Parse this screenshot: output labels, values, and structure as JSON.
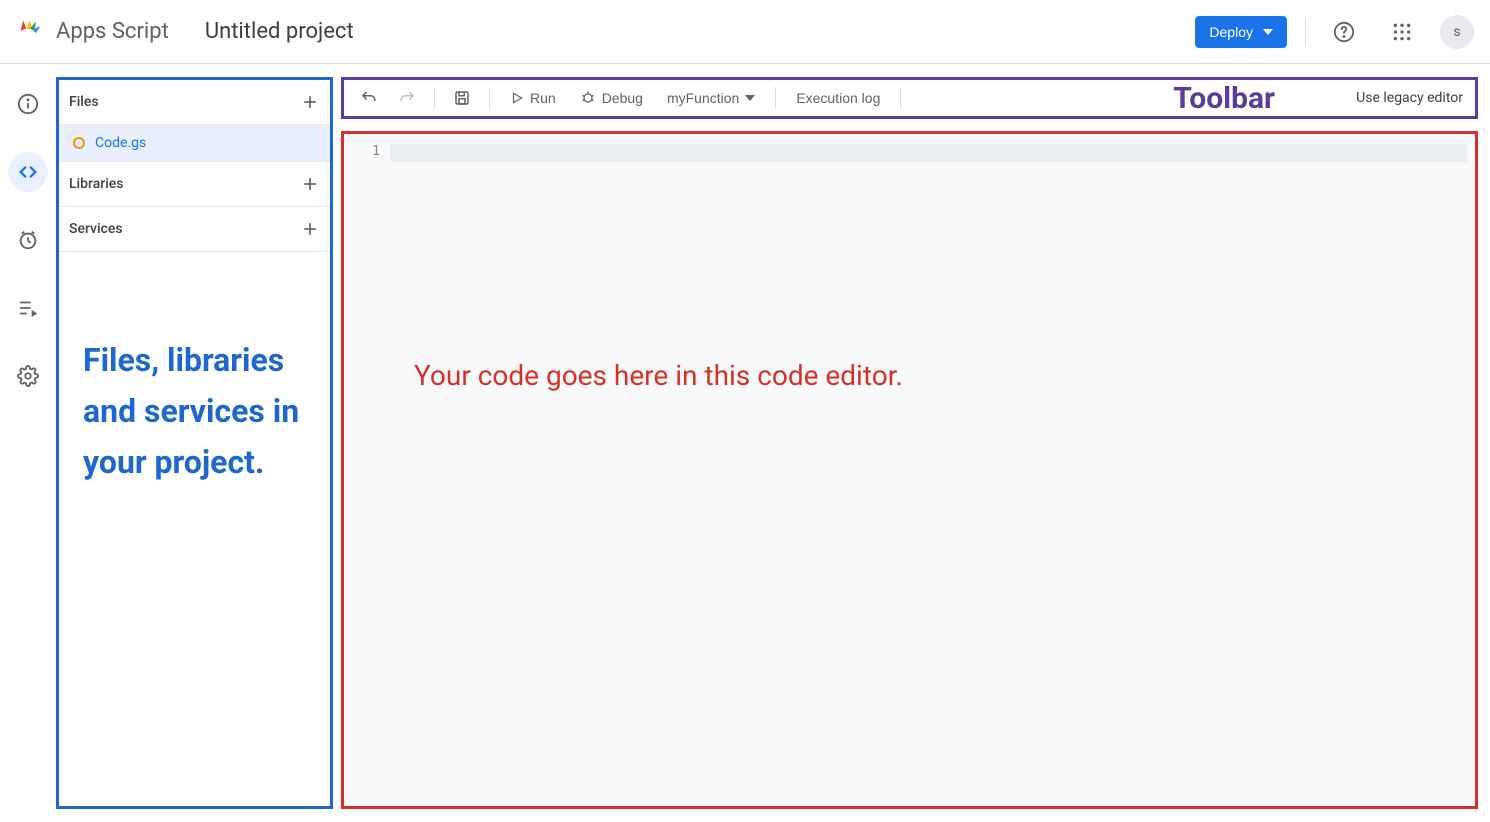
{
  "header": {
    "app_name": "Apps Script",
    "project_title": "Untitled project",
    "deploy_label": "Deploy",
    "avatar_initial": "s"
  },
  "left_rail": {
    "items": [
      "overview",
      "editor",
      "triggers",
      "executions",
      "settings"
    ],
    "active": "editor"
  },
  "sidebar": {
    "sections": [
      {
        "label": "Files"
      },
      {
        "label": "Libraries"
      },
      {
        "label": "Services"
      }
    ],
    "files": [
      {
        "name": "Code.gs",
        "modified": true
      }
    ],
    "annotation": "Files, libraries and services in your project."
  },
  "toolbar": {
    "run_label": "Run",
    "debug_label": "Debug",
    "function_selected": "myFunction",
    "exec_log_label": "Execution log",
    "annotation": "Toolbar",
    "legacy_link": "Use legacy editor"
  },
  "editor": {
    "line_numbers": [
      "1"
    ],
    "annotation": "Your code goes here in this code editor."
  }
}
